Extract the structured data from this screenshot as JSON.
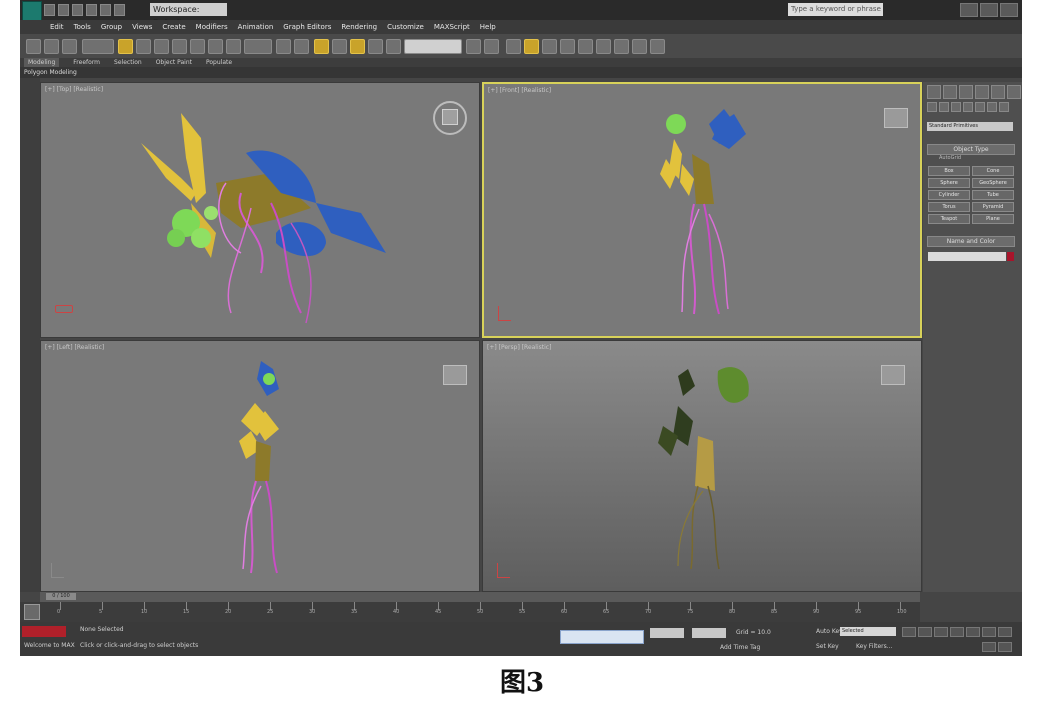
{
  "app": {
    "workspace_label": "Workspace: Default",
    "search_placeholder": "Type a keyword or phrase"
  },
  "menu": [
    "Edit",
    "Tools",
    "Group",
    "Views",
    "Create",
    "Modifiers",
    "Animation",
    "Graph Editors",
    "Rendering",
    "Customize",
    "MAXScript",
    "Help"
  ],
  "ribbon": {
    "tabs": [
      "Modeling",
      "Freeform",
      "Selection",
      "Object Paint",
      "Populate"
    ],
    "active_tab": "Modeling",
    "panel_label": "Polygon Modeling"
  },
  "viewports": {
    "top_left": "[+] [Top] [Realistic]",
    "top_right": "[+] [Front] [Realistic]",
    "bottom_left": "[+] [Left] [Realistic]",
    "bottom_right": "[+] [Persp] [Realistic]"
  },
  "command_panel": {
    "dropdown": "Standard Primitives",
    "object_type": "Object Type",
    "autogrid": "AutoGrid",
    "objects": [
      "Box",
      "Cone",
      "Sphere",
      "GeoSphere",
      "Cylinder",
      "Tube",
      "Torus",
      "Pyramid",
      "Teapot",
      "Plane"
    ],
    "name_color": "Name and Color",
    "object_color": "#a8142b"
  },
  "timeline": {
    "frame_display": "0 / 100",
    "ticks": [
      "0",
      "5",
      "10",
      "15",
      "20",
      "25",
      "30",
      "35",
      "40",
      "45",
      "50",
      "55",
      "60",
      "65",
      "70",
      "75",
      "80",
      "85",
      "90",
      "95",
      "100"
    ]
  },
  "status": {
    "welcome": "Welcome to MAX",
    "selection": "None Selected",
    "prompt": "Click or click-and-drag to select objects",
    "grid": "Grid = 10.0",
    "auto_key": "Auto Key",
    "selected": "Selected",
    "set_key": "Set Key",
    "key_filters": "Key Filters...",
    "add_time_tag": "Add Time Tag"
  },
  "caption": "图3"
}
